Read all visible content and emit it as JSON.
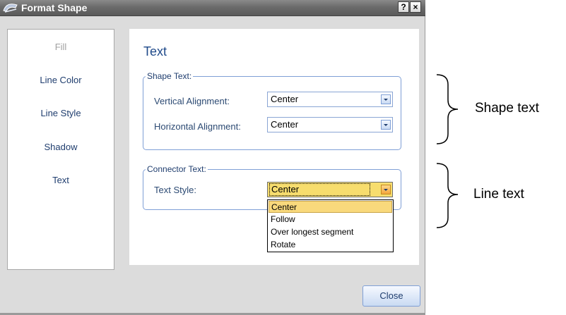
{
  "window": {
    "title": "Format Shape",
    "help_label": "?",
    "close_label": "×"
  },
  "sidebar": {
    "items": [
      {
        "label": "Fill",
        "state": "inactive"
      },
      {
        "label": "Line Color",
        "state": "active"
      },
      {
        "label": "Line Style",
        "state": "active"
      },
      {
        "label": "Shadow",
        "state": "active"
      },
      {
        "label": "Text",
        "state": "active"
      }
    ]
  },
  "main": {
    "title": "Text",
    "shape_text": {
      "legend": "Shape Text:",
      "vertical": {
        "label": "Vertical Alignment:",
        "value": "Center"
      },
      "horizontal": {
        "label": "Horizontal Alignment:",
        "value": "Center"
      }
    },
    "connector_text": {
      "legend": "Connector Text:",
      "text_style": {
        "label": "Text Style:",
        "value": "Center",
        "options": [
          "Center",
          "Follow",
          "Over longest segment",
          "Rotate"
        ],
        "selected_index": 0
      }
    }
  },
  "footer": {
    "close_label": "Close"
  },
  "annotations": {
    "shape": "Shape text",
    "line": "Line text"
  },
  "colors": {
    "accent": "#1f3d6e",
    "selection": "#f9d97c",
    "group_border": "#7f9fd6"
  }
}
